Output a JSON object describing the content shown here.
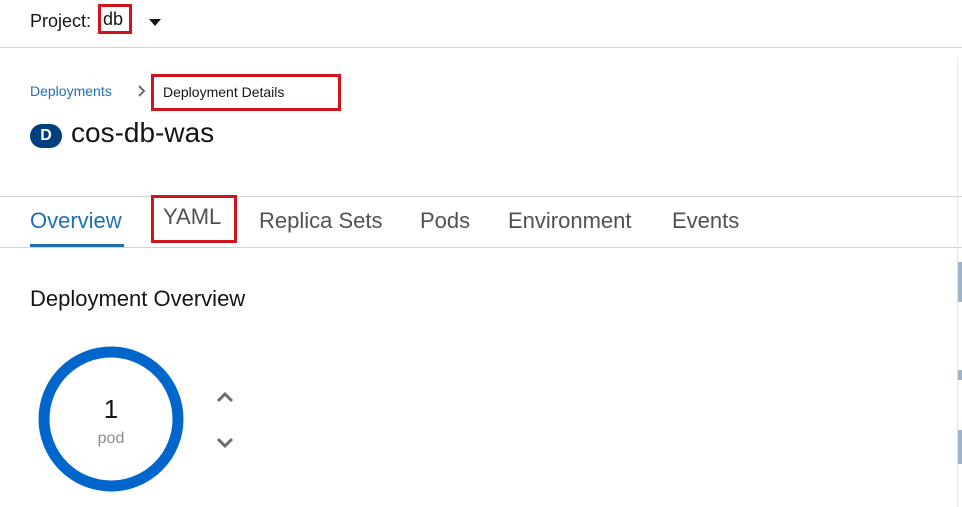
{
  "project": {
    "label": "Project:",
    "name": "db"
  },
  "breadcrumb": {
    "parent": "Deployments",
    "current": "Deployment Details"
  },
  "resource": {
    "badge": "D",
    "title": "cos-db-was"
  },
  "tabs": [
    {
      "label": "Overview"
    },
    {
      "label": "YAML"
    },
    {
      "label": "Replica Sets"
    },
    {
      "label": "Pods"
    },
    {
      "label": "Environment"
    },
    {
      "label": "Events"
    }
  ],
  "overview": {
    "heading": "Deployment Overview",
    "pod_count": "1",
    "pod_unit": "pod"
  },
  "colors": {
    "accent": "#1f6fb2",
    "highlight": "#d0141d",
    "badge": "#004080",
    "donut": "#0066cc"
  },
  "icons": [
    "caret-down-icon",
    "chevron-right-icon",
    "chevron-up-icon",
    "chevron-down-icon"
  ]
}
